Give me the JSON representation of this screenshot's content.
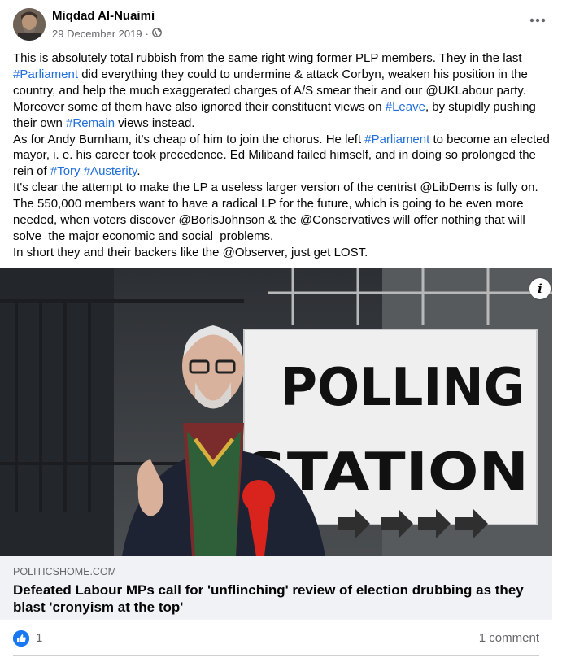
{
  "post": {
    "author": "Miqdad Al-Nuaimi",
    "date": "29 December 2019",
    "date_separator": " · ",
    "privacy_icon": "globe-icon",
    "menu_icon": "more-dots-icon",
    "text": [
      {
        "t": "This is absolutely total rubbish from the same right wing former PLP members. They in the last "
      },
      {
        "t": "#Parliament",
        "tag": true
      },
      {
        "t": " did everything they could to undermine & attack Corbyn, weaken his position in the country, and help the much exaggerated charges of A/S smear their and our @UKLabour party. Moreover some of them have also ignored their constituent views on "
      },
      {
        "t": "#Leave",
        "tag": true
      },
      {
        "t": ", by stupidly pushing their own "
      },
      {
        "t": "#Remain",
        "tag": true
      },
      {
        "t": " views instead.\nAs for Andy Burnham, it's cheap of him to join the chorus. He left "
      },
      {
        "t": "#Parliament",
        "tag": true
      },
      {
        "t": " to become an elected mayor, i. e. his career took precedence. Ed Miliband failed himself, and in doing so prolonged the rein of "
      },
      {
        "t": "#Tory",
        "tag": true
      },
      {
        "t": " "
      },
      {
        "t": "#Austerity",
        "tag": true
      },
      {
        "t": ".\nIt's clear the attempt to make the LP a useless larger version of the centrist @LibDems is fully on. The 550,000 members want to have a radical LP for the future, which is going to be even more needed, when voters discover @BorisJohnson & the @Conservatives will offer nothing that will solve  the major economic and social  problems.\nIn short they and their backers like the @Observer, just get LOST."
      }
    ],
    "hashtag_color": "#216fdb"
  },
  "image": {
    "sign_line1": "POLLING",
    "sign_line2": "STATION",
    "info_label": "i"
  },
  "link": {
    "domain": "POLITICSHOME.COM",
    "title": "Defeated Labour MPs call for 'unflinching' review of election drubbing as they blast 'cronyism at the top'"
  },
  "stats": {
    "reaction_icon": "like-icon",
    "like_count": "1",
    "comment_count": "1 comment"
  },
  "colors": {
    "accent": "#1877f2",
    "secondary_text": "#65676b",
    "link_bg": "#f0f2f5"
  }
}
